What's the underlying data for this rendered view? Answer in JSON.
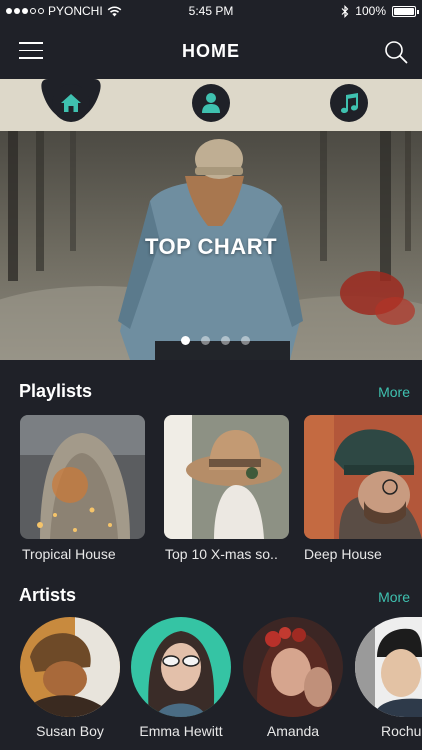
{
  "status_bar": {
    "carrier": "PYONCHI",
    "time": "5:45 PM",
    "battery": "100%"
  },
  "header": {
    "title": "HOME",
    "menu_icon": "hamburger-menu-icon",
    "search_icon": "search-icon"
  },
  "tabs": [
    {
      "name": "home",
      "icon": "home-icon",
      "active": true
    },
    {
      "name": "artists",
      "icon": "person-icon",
      "active": false
    },
    {
      "name": "music",
      "icon": "music-note-icon",
      "active": false
    }
  ],
  "hero": {
    "title": "TOP CHART",
    "slides_total": 4,
    "active_slide": 1
  },
  "playlists": {
    "title": "Playlists",
    "more_label": "More",
    "items": [
      {
        "label": "Tropical House"
      },
      {
        "label": "Top 10 X-mas so.."
      },
      {
        "label": "Deep House"
      }
    ]
  },
  "artists": {
    "title": "Artists",
    "more_label": "More",
    "items": [
      {
        "label": "Susan Boy"
      },
      {
        "label": "Emma Hewitt"
      },
      {
        "label": "Amanda"
      },
      {
        "label": "Rochu"
      }
    ]
  },
  "colors": {
    "background": "#1f2128",
    "accent": "#3fc1b0",
    "tabbar": "#ddd8c9"
  }
}
